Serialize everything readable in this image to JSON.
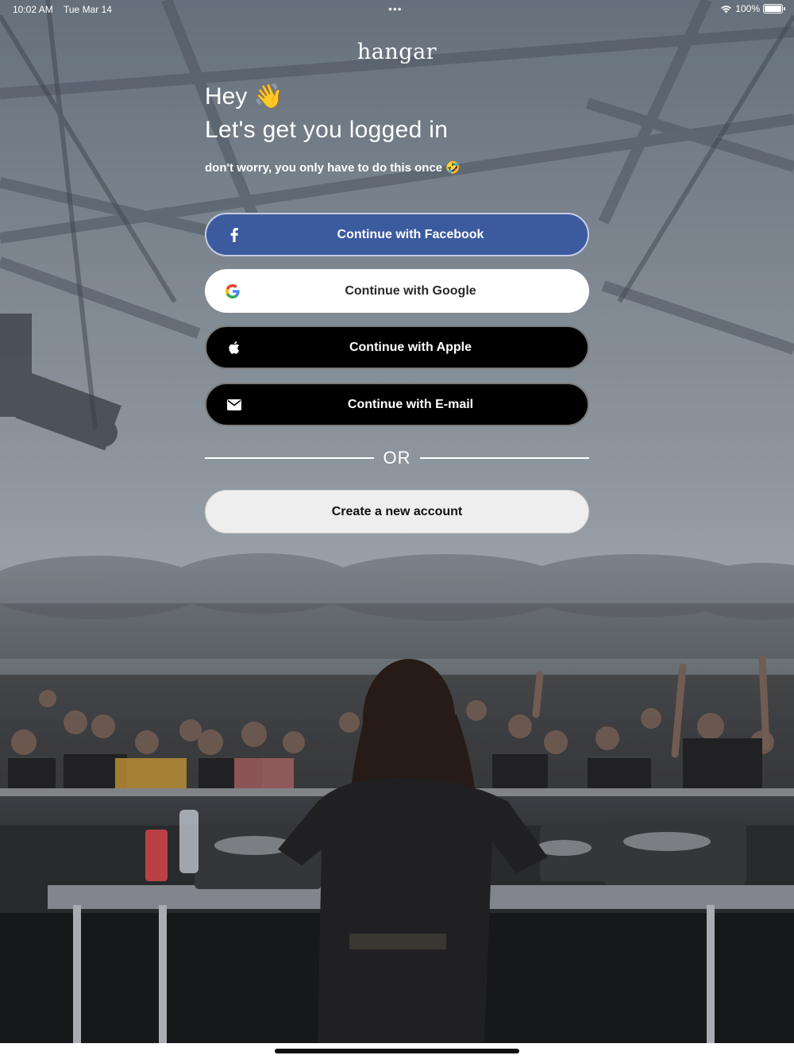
{
  "status_bar": {
    "time": "10:02 AM",
    "date": "Tue Mar 14",
    "dots": "•••",
    "battery": "100%"
  },
  "brand": {
    "logo": "hangar"
  },
  "intro": {
    "greeting": "Hey",
    "greeting_emoji": "👋",
    "headline": "Let's get you logged in",
    "subline": "don't worry, you only have to do this once",
    "subline_emoji": "🤣"
  },
  "buttons": {
    "facebook": {
      "label": "Continue with Facebook",
      "icon": "facebook-icon",
      "color": "#3c5a9e"
    },
    "google": {
      "label": "Continue with Google",
      "icon": "google-icon",
      "color": "#ffffff"
    },
    "apple": {
      "label": "Continue with Apple",
      "icon": "apple-icon",
      "color": "#000000"
    },
    "email": {
      "label": "Continue with E-mail",
      "icon": "mail-icon",
      "color": "#000000"
    }
  },
  "divider": {
    "text": "OR"
  },
  "create_account": {
    "label": "Create a new account"
  }
}
